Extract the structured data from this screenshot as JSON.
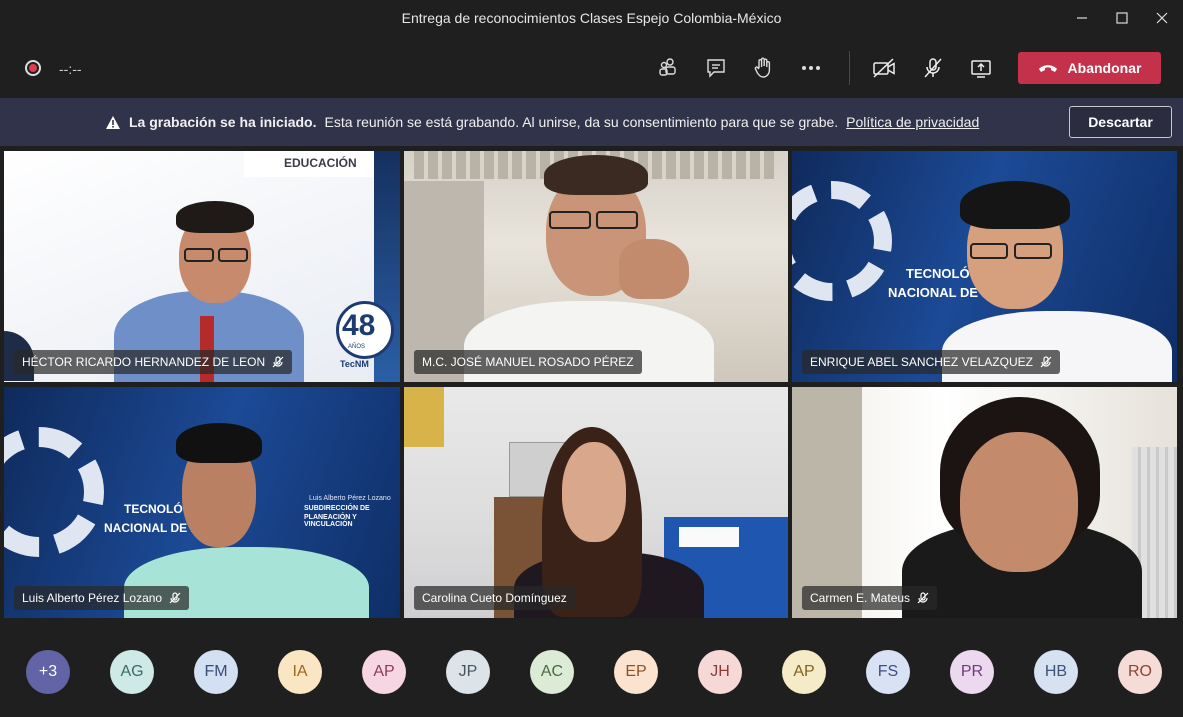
{
  "window": {
    "title": "Entrega de reconocimientos Clases Espejo Colombia-México"
  },
  "toolbar": {
    "timer": "--:--",
    "leave_label": "Abandonar"
  },
  "banner": {
    "bold_text": "La grabación se ha iniciado.",
    "text": "Esta reunión se está grabando. Al unirse, da su consentimiento para que se grabe.",
    "link_text": "Política de privacidad",
    "dismiss_label": "Descartar"
  },
  "tiles": [
    {
      "name": "HÉCTOR RICARDO HERNANDEZ DE LEON"
    },
    {
      "name": "M.C. JOSÉ MANUEL ROSADO PÉREZ"
    },
    {
      "name": "ENRIQUE ABEL SANCHEZ VELAZQUEZ"
    },
    {
      "name": "Luis Alberto Pérez Lozano"
    },
    {
      "name": "Carolina Cueto Domínguez"
    },
    {
      "name": "Carmen E. Mateus"
    }
  ],
  "backgrounds": {
    "educacion": "EDUCACIÓN",
    "anniversary_number": "48",
    "anniversary_word": "AÑOS",
    "tecnm": "TecNM",
    "tecnologico": "TECNOLÓGICO",
    "nacional": "NACIONAL DE MÉ",
    "tecnologic_short": "TECNOLÓGIC",
    "nacional_short": "NACIONAL DE MÉ",
    "sub_name": "Luis Alberto Pérez Lozano",
    "sub_line1": "SUBDIRECCIÓN DE",
    "sub_line2": "PLANEACIÓN Y VINCULACIÓN"
  },
  "participants": [
    {
      "initials": "+3",
      "bg": "#6264a7",
      "fg": "#ffffff"
    },
    {
      "initials": "AG",
      "bg": "#cfe9e7",
      "fg": "#3a6b66"
    },
    {
      "initials": "FM",
      "bg": "#d3dff3",
      "fg": "#3b4d77"
    },
    {
      "initials": "IA",
      "bg": "#fbe6c4",
      "fg": "#9a6a1c"
    },
    {
      "initials": "AP",
      "bg": "#f6d6e3",
      "fg": "#8f3b5c"
    },
    {
      "initials": "JP",
      "bg": "#dde4e9",
      "fg": "#44565f"
    },
    {
      "initials": "AC",
      "bg": "#dcebd6",
      "fg": "#4b6a3d"
    },
    {
      "initials": "EP",
      "bg": "#fbe3cf",
      "fg": "#8a5426"
    },
    {
      "initials": "JH",
      "bg": "#f6d9d7",
      "fg": "#8d3d38"
    },
    {
      "initials": "AP",
      "bg": "#f6ebc8",
      "fg": "#7d6420"
    },
    {
      "initials": "FS",
      "bg": "#d9e2f5",
      "fg": "#3c4f82"
    },
    {
      "initials": "PR",
      "bg": "#ecd9ef",
      "fg": "#6f3b7c"
    },
    {
      "initials": "HB",
      "bg": "#d6e1f1",
      "fg": "#3d5478"
    },
    {
      "initials": "RO",
      "bg": "#f6dcd6",
      "fg": "#8c4436"
    }
  ]
}
